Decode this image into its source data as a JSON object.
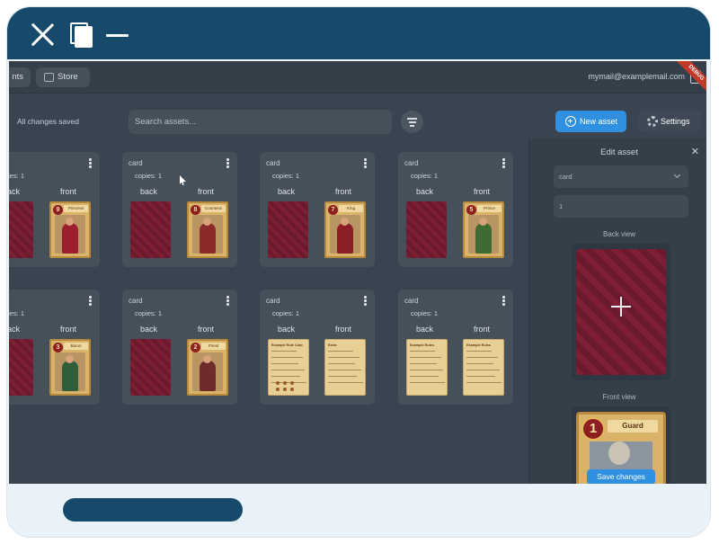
{
  "window_controls": {
    "close": "close-icon",
    "duplicate": "copy-icon",
    "minimize": "minimize-icon"
  },
  "app": {
    "nav": [
      {
        "label": "nts"
      },
      {
        "label": "Store",
        "icon": "store-icon"
      }
    ],
    "user_email": "mymail@examplemail.com",
    "debug_ribbon": "DEBUG"
  },
  "toolbar": {
    "status": "All changes saved",
    "search_placeholder": "Search assets...",
    "new_asset_label": "New asset",
    "settings_label": "Settings"
  },
  "assets": [
    {
      "type": "card",
      "copies": "copies: 1",
      "back_label": "back",
      "front_label": "front",
      "front_kind": "character",
      "cost": "9",
      "name": "Princess",
      "color": "#9b1f2e"
    },
    {
      "type": "card",
      "copies": "copies: 1",
      "back_label": "back",
      "front_label": "front",
      "front_kind": "character",
      "cost": "8",
      "name": "Countess",
      "color": "#8c2a2a"
    },
    {
      "type": "card",
      "copies": "copies: 1",
      "back_label": "back",
      "front_label": "front",
      "front_kind": "character",
      "cost": "7",
      "name": "King",
      "color": "#8b1e27"
    },
    {
      "type": "card",
      "copies": "copies: 1",
      "back_label": "back",
      "front_label": "front",
      "front_kind": "character",
      "cost": "5",
      "name": "Prince",
      "color": "#3f6a32"
    },
    {
      "type": "card",
      "copies": "copies: 1",
      "back_label": "back",
      "front_label": "front",
      "front_kind": "character",
      "cost": "3",
      "name": "Baron",
      "color": "#2f5f3a"
    },
    {
      "type": "card",
      "copies": "copies: 1",
      "back_label": "back",
      "front_label": "front",
      "front_kind": "character",
      "cost": "2",
      "name": "Priest",
      "color": "#6e2b2b"
    },
    {
      "type": "card",
      "copies": "copies: 1",
      "back_label": "back",
      "front_label": "front",
      "front_kind": "rules",
      "back_heading": "Example Rule Card",
      "front_heading": "Extra"
    },
    {
      "type": "card",
      "copies": "copies: 1",
      "back_label": "back",
      "front_label": "front",
      "front_kind": "rules",
      "back_heading": "Example Rules",
      "front_heading": "Example Rules"
    }
  ],
  "panel": {
    "title": "Edit asset",
    "close_icon": "close-icon",
    "type_value": "card",
    "copies_value": "1",
    "back_view_label": "Back view",
    "front_view_label": "Front view",
    "front_cost": "1",
    "front_name": "Guard",
    "save_label": "Save changes"
  }
}
